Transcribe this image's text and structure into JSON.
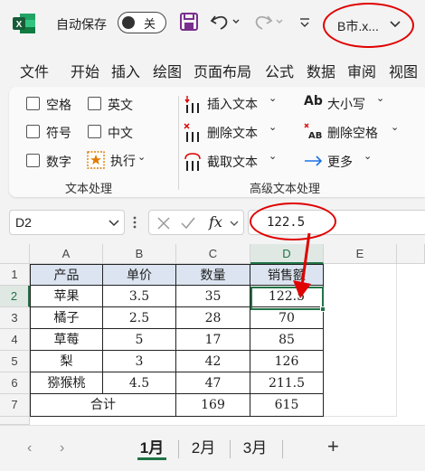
{
  "colors": {
    "accent": "#217346",
    "annotation": "#e00000",
    "header_fill": "#dbe4f0"
  },
  "titlebar": {
    "app_icon": "excel-logo",
    "autosave_label": "自动保存",
    "autosave_state": "关",
    "file_name": "B市.x...",
    "icons": [
      "save-icon",
      "undo-icon",
      "redo-icon",
      "customize-qat-icon",
      "chevron-down-icon"
    ]
  },
  "menu": [
    "文件",
    "开始",
    "插入",
    "绘图",
    "页面布局",
    "公式",
    "数据",
    "审阅",
    "视图"
  ],
  "ribbon": {
    "checkboxes": [
      "空格",
      "英文",
      "符号",
      "中文",
      "数字"
    ],
    "execute_label": "执行",
    "group1_label": "文本处理",
    "advanced": {
      "insert_text": "插入文本",
      "delete_text": "删除文本",
      "extract_text": "截取文本",
      "case": "大小写",
      "case_icon_text": "Ab",
      "delete_space": "删除空格",
      "delete_space_icon_text": "AB",
      "more": "更多"
    },
    "group2_label": "高级文本处理"
  },
  "formula_bar": {
    "name_box": "D2",
    "fx_label": "fx",
    "value": "122.5"
  },
  "grid": {
    "columns": [
      "A",
      "B",
      "C",
      "D",
      "E"
    ],
    "rows": [
      "1",
      "2",
      "3",
      "4",
      "5",
      "6",
      "7"
    ],
    "header": [
      "产品",
      "单价",
      "数量",
      "销售额"
    ],
    "data": [
      [
        "苹果",
        "3.5",
        "35",
        "122.5"
      ],
      [
        "橘子",
        "2.5",
        "28",
        "70"
      ],
      [
        "草莓",
        "5",
        "17",
        "85"
      ],
      [
        "梨",
        "3",
        "42",
        "126"
      ],
      [
        "猕猴桃",
        "4.5",
        "47",
        "211.5"
      ]
    ],
    "total_label": "合计",
    "total_qty": "169",
    "total_sales": "615"
  },
  "sheets": {
    "tabs": [
      "1月",
      "2月",
      "3月"
    ],
    "active": "1月",
    "add_label": "+"
  }
}
